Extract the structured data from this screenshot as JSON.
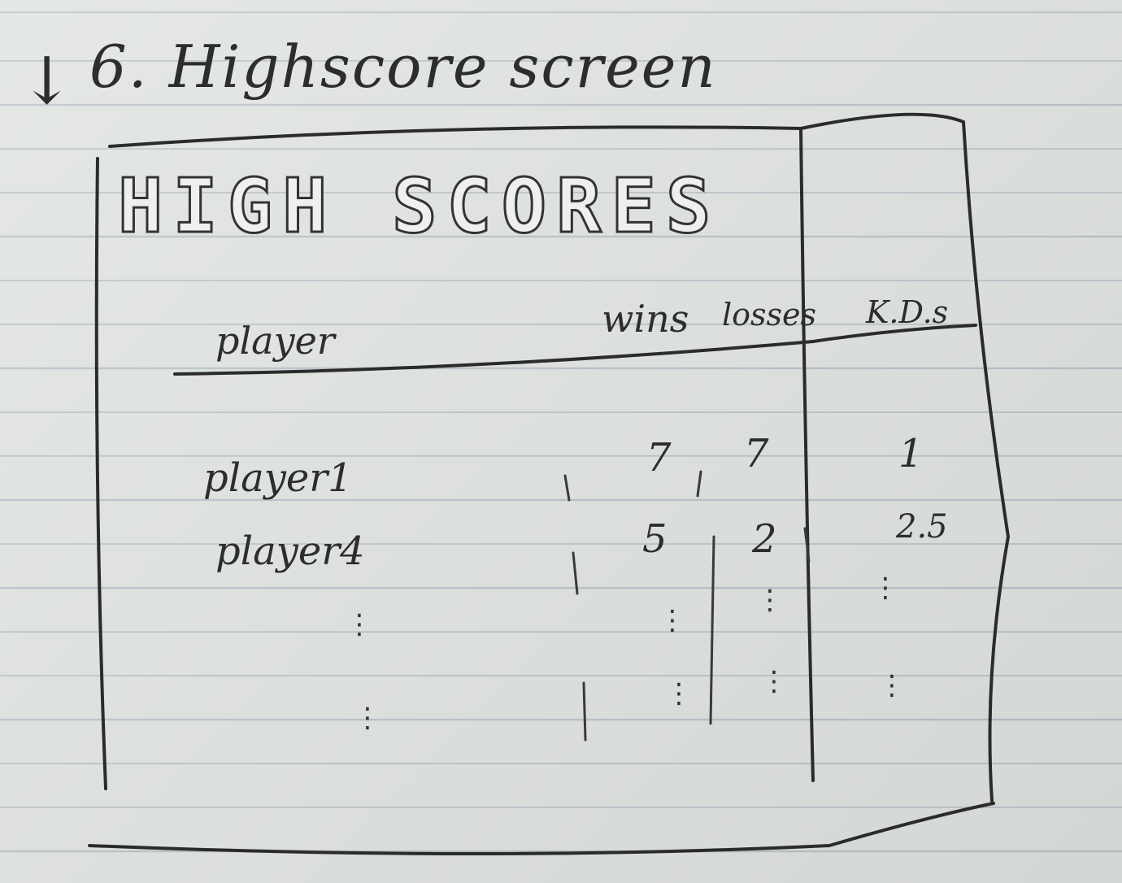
{
  "screen": {
    "number": "6.",
    "title": "Highscore screen",
    "arrow": "↓"
  },
  "header_art": "HIGH SCORES",
  "table": {
    "columns": [
      "player",
      "wins",
      "losses",
      "K.D.s"
    ],
    "rows": [
      {
        "player": "player1",
        "wins": "7",
        "losses": "7",
        "kd": "1"
      },
      {
        "player": "player4",
        "wins": "5",
        "losses": "2",
        "kd": "2.5"
      }
    ],
    "continuation": "⋮"
  }
}
